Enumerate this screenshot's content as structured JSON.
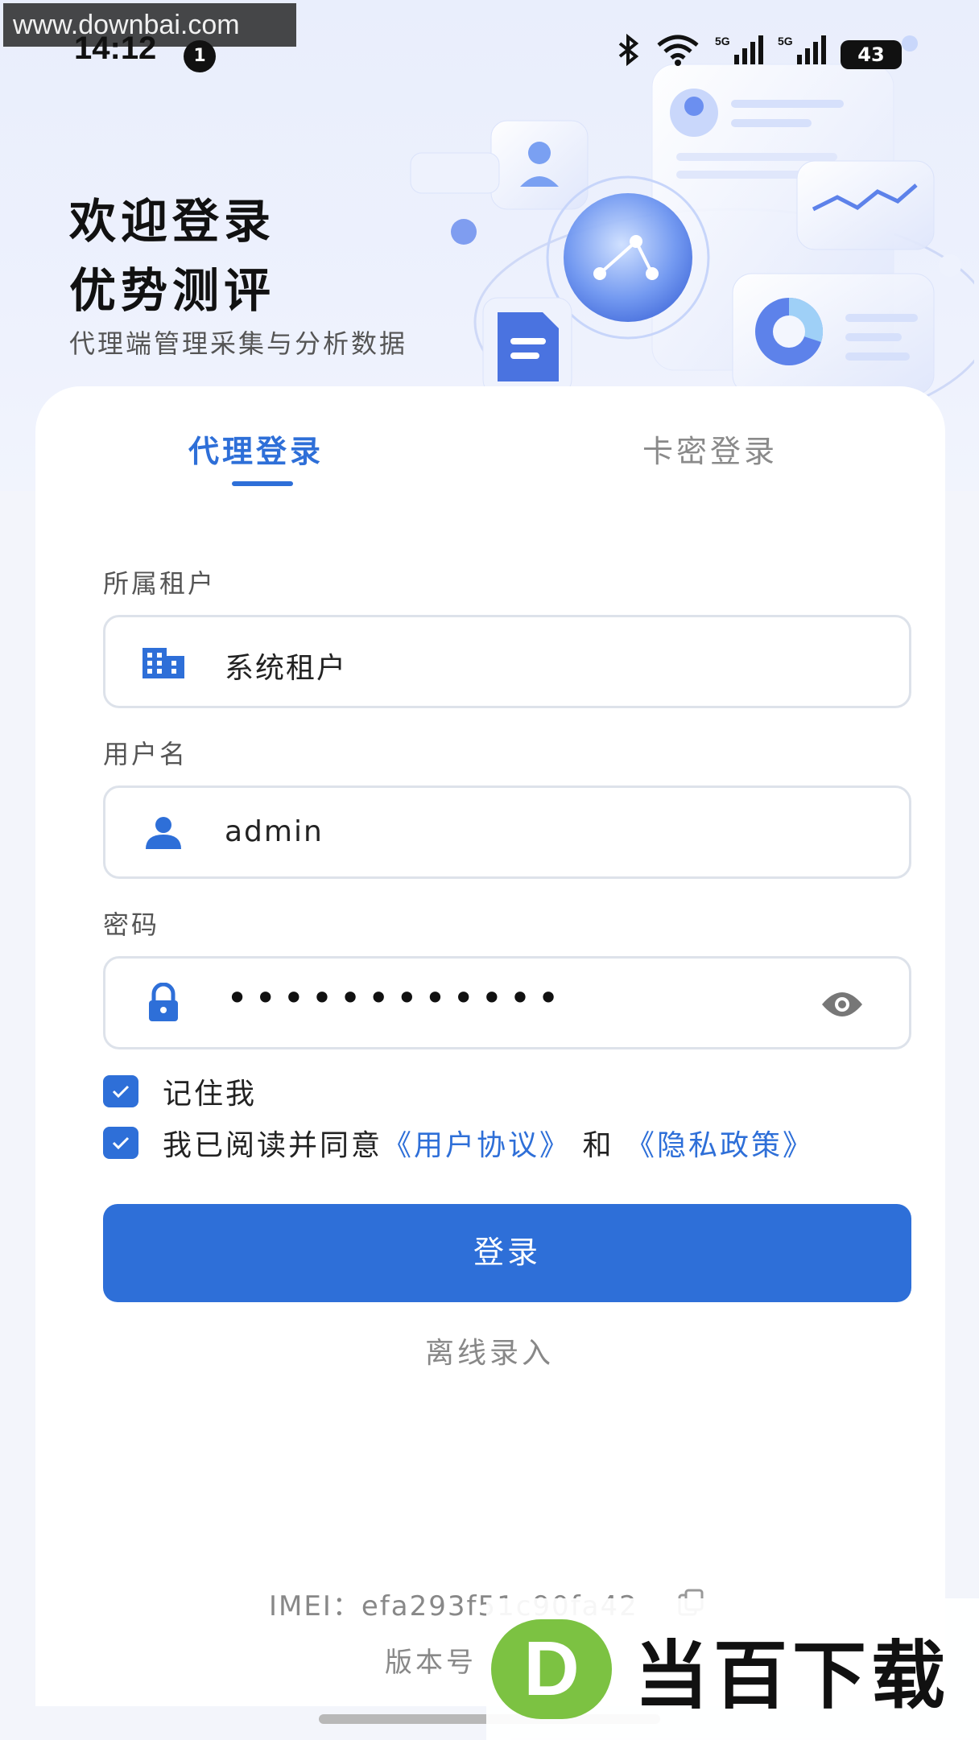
{
  "watermark": {
    "url": "www.downbai.com",
    "brand_letter": "D",
    "brand_name": "当百下载"
  },
  "status_bar": {
    "time": "14:12",
    "notification_count": "1",
    "signal_1": "5G",
    "signal_2": "5G",
    "battery": "43"
  },
  "hero": {
    "title_line1": "欢迎登录",
    "title_line2": "优势测评",
    "subtitle": "代理端管理采集与分析数据"
  },
  "tabs": [
    {
      "label": "代理登录",
      "active": true
    },
    {
      "label": "卡密登录",
      "active": false
    }
  ],
  "form": {
    "tenant": {
      "label": "所属租户",
      "value": "系统租户",
      "icon": "building-icon"
    },
    "username": {
      "label": "用户名",
      "value": "admin",
      "icon": "user-icon"
    },
    "password": {
      "label": "密码",
      "value_masked": "••••••••••••",
      "icon": "lock-icon",
      "toggle_icon": "eye-icon"
    },
    "remember_me": {
      "label": "记住我",
      "checked": true
    },
    "agreement": {
      "prefix": "我已阅读并同意",
      "user_agreement": "《用户协议》",
      "and": "和",
      "privacy_policy": "《隐私政策》",
      "checked": true
    },
    "login_button": "登录",
    "offline_entry": "离线录入"
  },
  "footer": {
    "imei": "IMEI：efa293f51c90fa42",
    "version_label": "版本号"
  },
  "colors": {
    "accent": "#2e6fd8",
    "background": "#f3f5fb",
    "card": "#ffffff",
    "muted_text": "#888888"
  }
}
